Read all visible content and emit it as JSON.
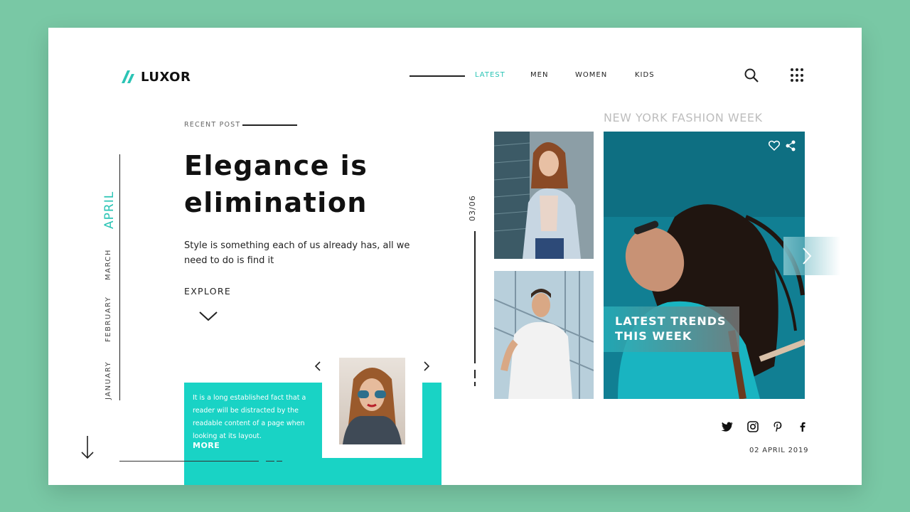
{
  "brand": {
    "name": "LUXOR",
    "accent": "#2bc4b5",
    "teal": "#19d3c5"
  },
  "nav": {
    "items": [
      {
        "label": "LATEST",
        "active": true
      },
      {
        "label": "MEN",
        "active": false
      },
      {
        "label": "WOMEN",
        "active": false
      },
      {
        "label": "KIDS",
        "active": false
      }
    ],
    "icons": [
      "search-icon",
      "grid-menu-icon"
    ]
  },
  "months": [
    {
      "label": "APRIL",
      "active": true
    },
    {
      "label": "MARCH",
      "active": false
    },
    {
      "label": "FEBRUARY",
      "active": false
    },
    {
      "label": "JANUARY",
      "active": false
    }
  ],
  "post": {
    "label": "RECENT POST",
    "title_line1": "Elegance is",
    "title_line2": "elimination",
    "subtitle": "Style is something each of us already has, all we need to do is find it",
    "explore": "EXPLORE"
  },
  "teaser": {
    "text": "It is a long established fact that a reader will be distracted by the readable content of a page when looking at its layout.",
    "more": "MORE"
  },
  "counter": "03/06",
  "featured": {
    "heading": "NEW YORK FASHION WEEK",
    "overlay_line1": "LATEST TRENDS",
    "overlay_line2": "THIS WEEK"
  },
  "social": [
    "twitter-icon",
    "instagram-icon",
    "pinterest-icon",
    "facebook-icon"
  ],
  "date": "02 APRIL 2019"
}
